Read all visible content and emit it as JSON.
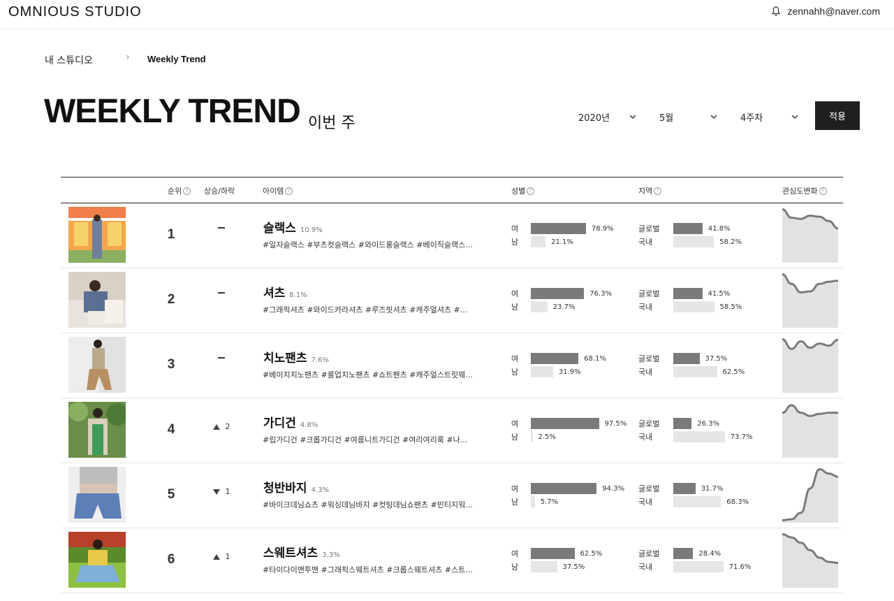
{
  "header": {
    "logo": "OMNIOUS STUDIO",
    "user_email": "zennahh@naver.com"
  },
  "breadcrumb": {
    "home": "내 스튜디오",
    "separator": "›",
    "current": "Weekly Trend"
  },
  "page": {
    "title": "WEEKLY TREND",
    "subtitle": "이번 주"
  },
  "filters": {
    "year": "2020년",
    "month": "5월",
    "week": "4주차",
    "apply_label": "적용"
  },
  "table": {
    "headers": {
      "rank": "순위",
      "change": "상승/하락",
      "item": "아이템",
      "gender": "성별",
      "region": "지역",
      "interest": "관심도변화"
    },
    "gender_labels": {
      "female": "여",
      "male": "남"
    },
    "region_labels": {
      "global": "글로벌",
      "domestic": "국내"
    },
    "rows": [
      {
        "rank": "1",
        "change_dir": "same",
        "change": "",
        "name": "슬랙스",
        "share": "10.9%",
        "tags": "#일자슬랙스 #부츠컷슬랙스 #와이드롱슬랙스 #베이직슬랙스...",
        "female": 78.9,
        "female_label": "78.9%",
        "male": 21.1,
        "male_label": "21.1%",
        "global": 41.8,
        "global_label": "41.8%",
        "domestic": 58.2,
        "domestic_label": "58.2%",
        "interest": [
          0.98,
          0.82,
          0.8,
          0.86,
          0.84,
          0.76,
          0.62
        ]
      },
      {
        "rank": "2",
        "change_dir": "same",
        "change": "",
        "name": "셔츠",
        "share": "8.1%",
        "tags": "#그래픽셔츠 #와이드카라셔츠 #루즈핏셔츠 #캐주얼셔츠 #...",
        "female": 76.3,
        "female_label": "76.3%",
        "male": 23.7,
        "male_label": "23.7%",
        "global": 41.5,
        "global_label": "41.5%",
        "domestic": 58.5,
        "domestic_label": "58.5%",
        "interest": [
          0.98,
          0.8,
          0.64,
          0.66,
          0.8,
          0.84,
          0.86
        ]
      },
      {
        "rank": "3",
        "change_dir": "same",
        "change": "",
        "name": "치노팬츠",
        "share": "7.6%",
        "tags": "#베이지치노팬츠 #롤업치노팬츠 #쇼트팬츠 #캐주얼스트릿웨...",
        "female": 68.1,
        "female_label": "68.1%",
        "male": 31.9,
        "male_label": "31.9%",
        "global": 37.5,
        "global_label": "37.5%",
        "domestic": 62.5,
        "domestic_label": "62.5%",
        "interest": [
          0.98,
          0.8,
          0.94,
          0.82,
          0.9,
          0.86,
          0.97
        ]
      },
      {
        "rank": "4",
        "change_dir": "up",
        "change": "2",
        "name": "가디건",
        "share": "4.8%",
        "tags": "#립가디건 #크롭가디건 #여름니트가디건 #여리여리룩 #나...",
        "female": 97.5,
        "female_label": "97.5%",
        "male": 2.5,
        "male_label": "2.5%",
        "global": 26.3,
        "global_label": "26.3%",
        "domestic": 73.7,
        "domestic_label": "73.7%",
        "interest": [
          0.82,
          0.96,
          0.82,
          0.76,
          0.8,
          0.82,
          0.82
        ]
      },
      {
        "rank": "5",
        "change_dir": "down",
        "change": "1",
        "name": "청반바지",
        "share": "4.3%",
        "tags": "#바이크데님쇼츠 #워싱데님바지 #컷팅데님쇼팬츠 #빈티지워...",
        "female": 94.3,
        "female_label": "94.3%",
        "male": 5.7,
        "male_label": "5.7%",
        "global": 31.7,
        "global_label": "31.7%",
        "domestic": 68.3,
        "domestic_label": "68.3%",
        "interest": [
          0.02,
          0.04,
          0.16,
          0.62,
          0.98,
          0.9,
          0.84
        ]
      },
      {
        "rank": "6",
        "change_dir": "up",
        "change": "1",
        "name": "스웨트셔츠",
        "share": "3.3%",
        "tags": "#타이다이맨투맨 #그래픽스웨트셔츠 #크롭스웨트셔츠 #스트...",
        "female": 62.5,
        "female_label": "62.5%",
        "male": 37.5,
        "male_label": "37.5%",
        "global": 28.4,
        "global_label": "28.4%",
        "domestic": 71.6,
        "domestic_label": "71.6%",
        "interest": [
          0.98,
          0.92,
          0.82,
          0.68,
          0.54,
          0.46,
          0.44
        ]
      }
    ]
  }
}
